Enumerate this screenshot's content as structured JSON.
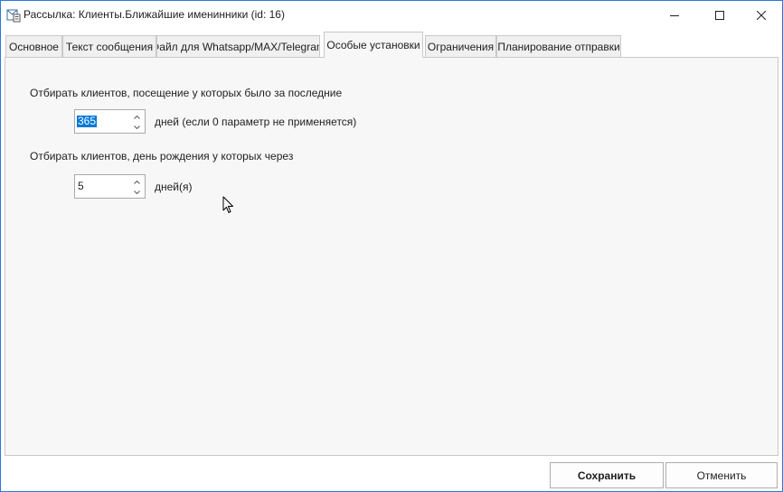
{
  "window": {
    "title": "Рассылка: Клиенты.Ближайшие именинники (id: 16)"
  },
  "tabs": [
    {
      "label": "Основное"
    },
    {
      "label": "Текст сообщения"
    },
    {
      "label": "Файл для Whatsapp/MAX/Telegram"
    },
    {
      "label": "Особые установки",
      "active": true
    },
    {
      "label": "Ограничения"
    },
    {
      "label": "Планирование отправки"
    }
  ],
  "settings": {
    "visit_label": "Отбирать клиентов, посещение у которых было за последние",
    "visit_value": "365",
    "visit_unit": "дней (если 0 параметр не применяется)",
    "birthday_label": "Отбирать клиентов, день рождения у которых через",
    "birthday_value": "5",
    "birthday_unit": "дней(я)"
  },
  "footer": {
    "save_label": "Сохранить",
    "cancel_label": "Отменить"
  },
  "icons": {
    "app": "mail-form-icon",
    "minimize": "minimize-icon",
    "maximize": "maximize-icon",
    "close": "close-icon",
    "spin_up": "chevron-up-icon",
    "spin_down": "chevron-down-icon",
    "cursor": "mouse-pointer-icon"
  },
  "colors": {
    "window_border": "#2b79d6",
    "selection": "#0078d7",
    "panel_background": "#f7f7f7"
  }
}
